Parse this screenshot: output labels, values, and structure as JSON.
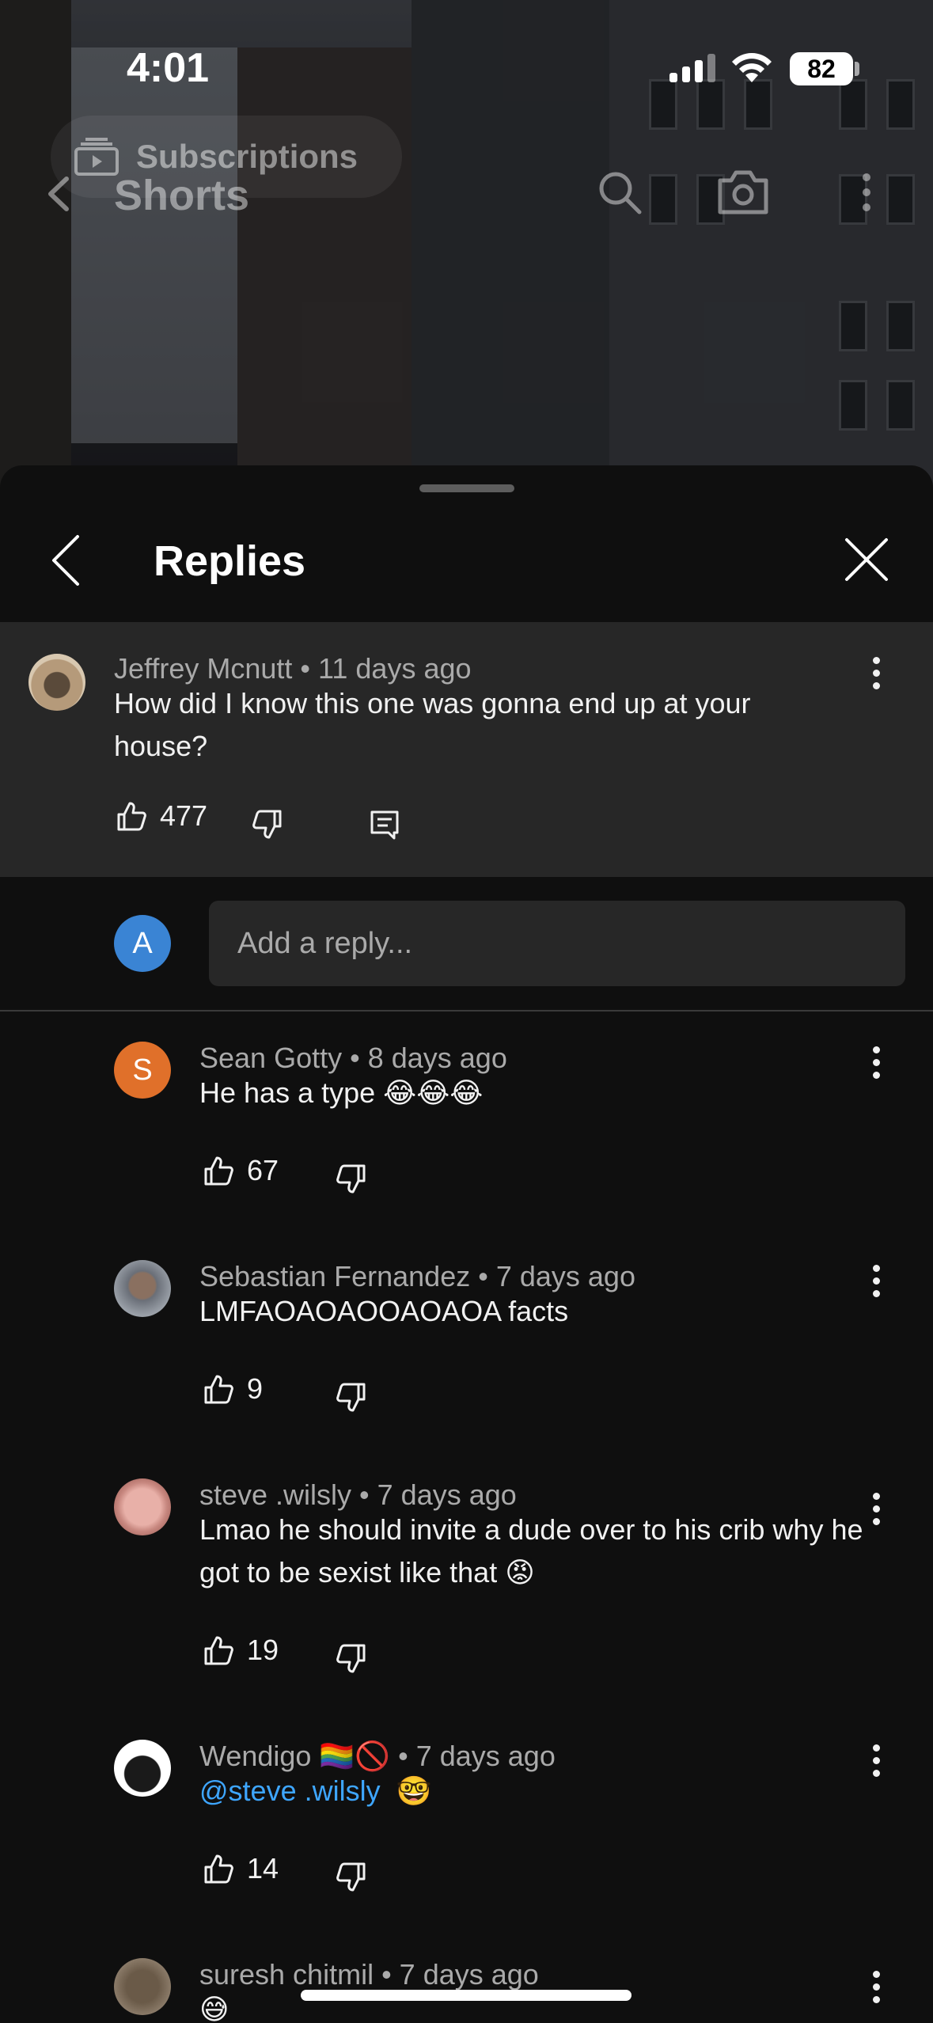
{
  "status_bar": {
    "time": "4:01",
    "battery": "82"
  },
  "top_bar": {
    "title": "Shorts",
    "chip": "Subscriptions"
  },
  "sheet": {
    "title": "Replies"
  },
  "parent_comment": {
    "author": "Jeffrey Mcnutt",
    "time": "11 days ago",
    "text": "How did I know this one was gonna end up at your house?",
    "likes": "477"
  },
  "reply_box": {
    "avatar_letter": "A",
    "placeholder": "Add a reply..."
  },
  "replies": [
    {
      "author": "Sean Gotty",
      "time": "8 days ago",
      "text": "He has a type 😂😂😂",
      "likes": "67",
      "avatar_letter": "S",
      "avatar_color": "#e0702a"
    },
    {
      "author": "Sebastian Fernandez",
      "time": "7 days ago",
      "text": "LMFAOAOAOOAOAOA facts",
      "likes": "9"
    },
    {
      "author": "steve .wilsly",
      "time": "7 days ago",
      "text": "Lmao he should invite a dude over to his crib why he got to be sexist like that 😡",
      "likes": "19"
    },
    {
      "author": "Wendigo 🏳️‍🌈🚫",
      "time": "7 days ago",
      "mention": "@steve .wilsly",
      "text": "🤓",
      "likes": "14"
    },
    {
      "author": "suresh chitmil",
      "time": "7 days ago",
      "text": "😅"
    }
  ],
  "colors": {
    "accent_link": "#3ea6ff",
    "reply_avatar": "#3a84d4",
    "sheet_bg": "#0f0f0f",
    "highlight_bg": "#272727"
  }
}
